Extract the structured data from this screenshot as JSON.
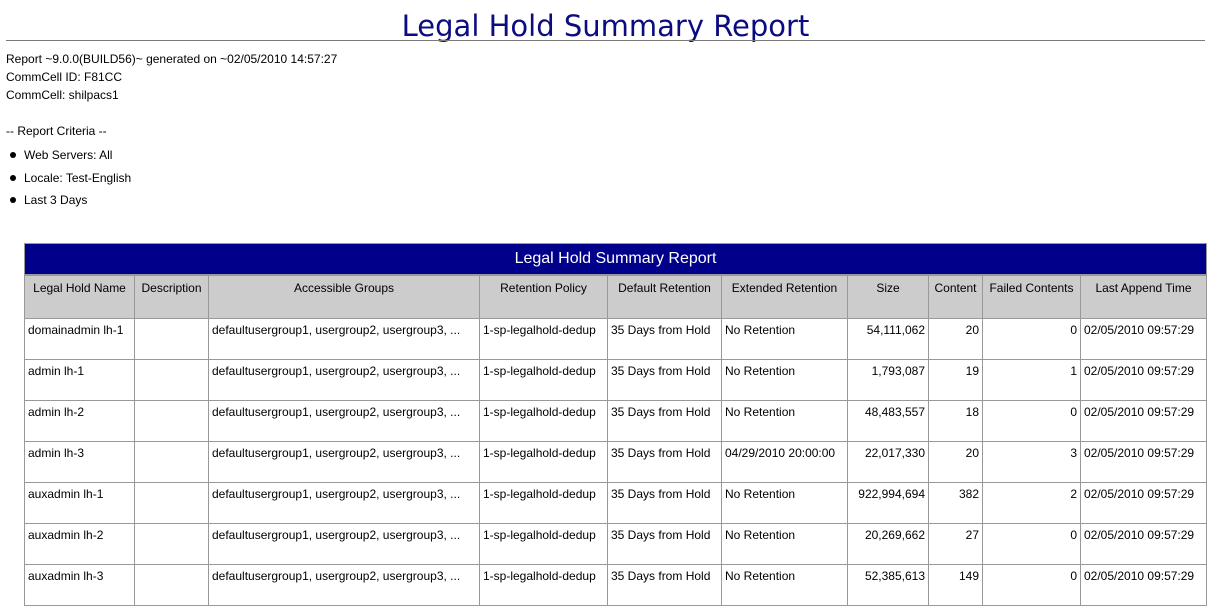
{
  "title": "Legal Hold Summary Report",
  "meta": {
    "report_line": "Report ~9.0.0(BUILD56)~ generated on ~02/05/2010 14:57:27",
    "commcell_id": "CommCell ID: F81CC",
    "commcell": "CommCell: shilpacs1"
  },
  "criteria": {
    "heading": "-- Report Criteria --",
    "items": [
      "Web Servers: All",
      "Locale: Test-English",
      "Last 3 Days"
    ]
  },
  "table": {
    "caption": "Legal Hold Summary Report",
    "headers": [
      "Legal Hold Name",
      "Description",
      "Accessible Groups",
      "Retention Policy",
      "Default Retention",
      "Extended Retention",
      "Size",
      "Content",
      "Failed Contents",
      "Last Append Time"
    ],
    "rows": [
      {
        "name": "domainadmin lh-1",
        "description": "",
        "groups": "defaultusergroup1, usergroup2, usergroup3, ...",
        "policy": "1-sp-legalhold-dedup",
        "default_retention": "35 Days from Hold",
        "extended_retention": "No Retention",
        "size": "54,111,062",
        "content": "20",
        "failed": "0",
        "last_append": "02/05/2010 09:57:29"
      },
      {
        "name": "admin lh-1",
        "description": "",
        "groups": "defaultusergroup1, usergroup2, usergroup3, ...",
        "policy": "1-sp-legalhold-dedup",
        "default_retention": "35 Days from Hold",
        "extended_retention": "No Retention",
        "size": "1,793,087",
        "content": "19",
        "failed": "1",
        "last_append": "02/05/2010 09:57:29"
      },
      {
        "name": "admin lh-2",
        "description": "",
        "groups": "defaultusergroup1, usergroup2, usergroup3, ...",
        "policy": "1-sp-legalhold-dedup",
        "default_retention": "35 Days from Hold",
        "extended_retention": "No Retention",
        "size": "48,483,557",
        "content": "18",
        "failed": "0",
        "last_append": "02/05/2010 09:57:29"
      },
      {
        "name": "admin lh-3",
        "description": "",
        "groups": "defaultusergroup1, usergroup2, usergroup3, ...",
        "policy": "1-sp-legalhold-dedup",
        "default_retention": "35 Days from Hold",
        "extended_retention": "04/29/2010 20:00:00",
        "size": "22,017,330",
        "content": "20",
        "failed": "3",
        "last_append": "02/05/2010 09:57:29"
      },
      {
        "name": "auxadmin lh-1",
        "description": "",
        "groups": "defaultusergroup1, usergroup2, usergroup3, ...",
        "policy": "1-sp-legalhold-dedup",
        "default_retention": "35 Days from Hold",
        "extended_retention": "No Retention",
        "size": "922,994,694",
        "content": "382",
        "failed": "2",
        "last_append": "02/05/2010 09:57:29"
      },
      {
        "name": "auxadmin lh-2",
        "description": "",
        "groups": "defaultusergroup1, usergroup2, usergroup3, ...",
        "policy": "1-sp-legalhold-dedup",
        "default_retention": "35 Days from Hold",
        "extended_retention": "No Retention",
        "size": "20,269,662",
        "content": "27",
        "failed": "0",
        "last_append": "02/05/2010 09:57:29"
      },
      {
        "name": "auxadmin lh-3",
        "description": "",
        "groups": "defaultusergroup1, usergroup2, usergroup3, ...",
        "policy": "1-sp-legalhold-dedup",
        "default_retention": "35 Days from Hold",
        "extended_retention": "No Retention",
        "size": "52,385,613",
        "content": "149",
        "failed": "0",
        "last_append": "02/05/2010 09:57:29"
      }
    ]
  }
}
